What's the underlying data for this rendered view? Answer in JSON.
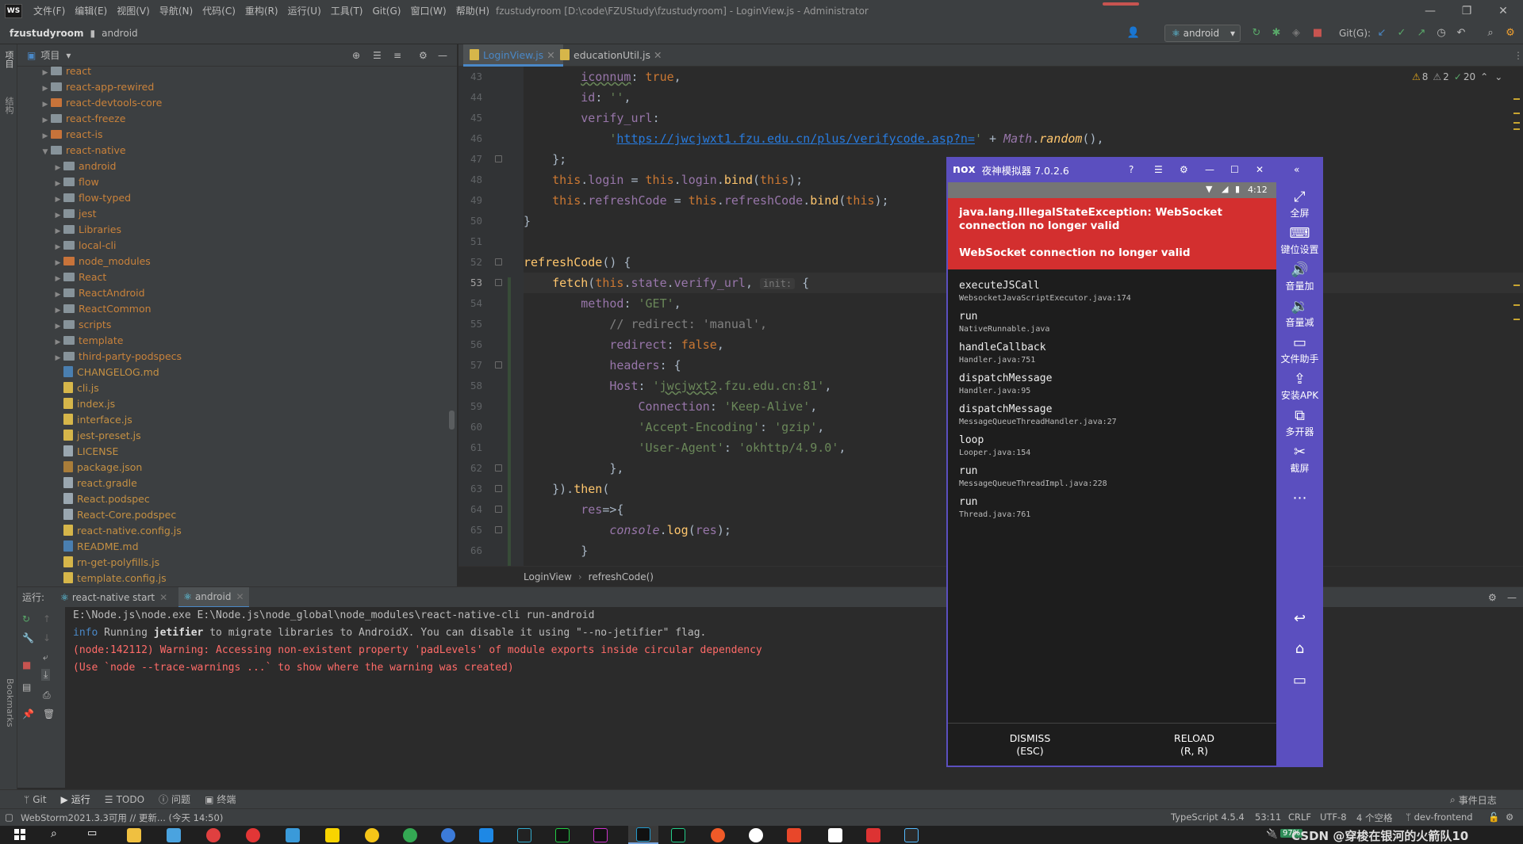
{
  "window": {
    "title": "fzustudyroom [D:\\code\\FZUStudy\\fzustudyroom] - LoginView.js - Administrator",
    "logo": "WS",
    "menus": [
      "文件(F)",
      "编辑(E)",
      "视图(V)",
      "导航(N)",
      "代码(C)",
      "重构(R)",
      "运行(U)",
      "工具(T)",
      "Git(G)",
      "窗口(W)",
      "帮助(H)"
    ],
    "controls": {
      "minimize": "—",
      "restore": "❐",
      "close": "✕"
    }
  },
  "navbar": {
    "project": "fzustudyroom",
    "folder": "android",
    "run_config": "android",
    "git_label": "Git(G):"
  },
  "project_panel": {
    "title": "项目",
    "tree": [
      {
        "label": "react",
        "type": "dir",
        "depth": 2,
        "expanded": false
      },
      {
        "label": "react-app-rewired",
        "type": "dir",
        "depth": 2,
        "expanded": false
      },
      {
        "label": "react-devtools-core",
        "type": "dir",
        "depth": 2,
        "expanded": false,
        "excluded": true
      },
      {
        "label": "react-freeze",
        "type": "dir",
        "depth": 2,
        "expanded": false
      },
      {
        "label": "react-is",
        "type": "dir",
        "depth": 2,
        "expanded": false,
        "excluded": true
      },
      {
        "label": "react-native",
        "type": "dir",
        "depth": 2,
        "expanded": true
      },
      {
        "label": "android",
        "type": "dir",
        "depth": 3,
        "expanded": false
      },
      {
        "label": "flow",
        "type": "dir",
        "depth": 3,
        "expanded": false
      },
      {
        "label": "flow-typed",
        "type": "dir",
        "depth": 3,
        "expanded": false
      },
      {
        "label": "jest",
        "type": "dir",
        "depth": 3,
        "expanded": false
      },
      {
        "label": "Libraries",
        "type": "dir",
        "depth": 3,
        "expanded": false
      },
      {
        "label": "local-cli",
        "type": "dir",
        "depth": 3,
        "expanded": false
      },
      {
        "label": "node_modules",
        "type": "dir",
        "depth": 3,
        "expanded": false,
        "excluded": true
      },
      {
        "label": "React",
        "type": "dir",
        "depth": 3,
        "expanded": false
      },
      {
        "label": "ReactAndroid",
        "type": "dir",
        "depth": 3,
        "expanded": false
      },
      {
        "label": "ReactCommon",
        "type": "dir",
        "depth": 3,
        "expanded": false
      },
      {
        "label": "scripts",
        "type": "dir",
        "depth": 3,
        "expanded": false
      },
      {
        "label": "template",
        "type": "dir",
        "depth": 3,
        "expanded": false
      },
      {
        "label": "third-party-podspecs",
        "type": "dir",
        "depth": 3,
        "expanded": false
      },
      {
        "label": "CHANGELOG.md",
        "type": "md",
        "depth": 3
      },
      {
        "label": "cli.js",
        "type": "js",
        "depth": 3
      },
      {
        "label": "index.js",
        "type": "js",
        "depth": 3
      },
      {
        "label": "interface.js",
        "type": "js",
        "depth": 3
      },
      {
        "label": "jest-preset.js",
        "type": "js",
        "depth": 3
      },
      {
        "label": "LICENSE",
        "type": "txt",
        "depth": 3
      },
      {
        "label": "package.json",
        "type": "json",
        "depth": 3
      },
      {
        "label": "react.gradle",
        "type": "txt",
        "depth": 3
      },
      {
        "label": "React.podspec",
        "type": "txt",
        "depth": 3
      },
      {
        "label": "React-Core.podspec",
        "type": "txt",
        "depth": 3
      },
      {
        "label": "react-native.config.js",
        "type": "js",
        "depth": 3
      },
      {
        "label": "README.md",
        "type": "md",
        "depth": 3
      },
      {
        "label": "rn-get-polyfills.js",
        "type": "js",
        "depth": 3
      },
      {
        "label": "template.config.js",
        "type": "js",
        "depth": 3
      }
    ]
  },
  "editor": {
    "tabs": [
      {
        "label": "LoginView.js",
        "active": true
      },
      {
        "label": "educationUtil.js",
        "active": false
      }
    ],
    "inspections": {
      "warnings": "8",
      "weak": "2",
      "ok": "20"
    },
    "line_numbers": [
      "43",
      "44",
      "45",
      "46",
      "47",
      "48",
      "49",
      "50",
      "51",
      "52",
      "53",
      "54",
      "55",
      "56",
      "57",
      "58",
      "59",
      "60",
      "61",
      "62",
      "63",
      "64",
      "65",
      "66"
    ],
    "current_line": "53",
    "breadcrumb": [
      "LoginView",
      "refreshCode()"
    ]
  },
  "run_panel": {
    "label": "运行:",
    "tabs": [
      "react-native start",
      "android"
    ],
    "lines": [
      {
        "text": "E:\\Node.js\\node.exe E:\\Node.js\\node_global\\node_modules\\react-native-cli run-android",
        "color": "#bbbbbb"
      },
      {
        "text": "(node:142112) Warning: Accessing non-existent property 'padLevels' of module exports inside circular dependency",
        "color": "#ff6b68"
      },
      {
        "text": "(Use `node --trace-warnings ...` to show where the warning was created)",
        "color": "#ff6b68"
      }
    ],
    "info_line": {
      "prefix": "info",
      "mid": " Running ",
      "bold": "jetifier",
      "rest": " to migrate libraries to AndroidX. You can disable it using \"--no-jetifier\" flag."
    }
  },
  "bottom_tools": [
    "Git",
    "运行",
    "TODO",
    "问题",
    "终端"
  ],
  "event_log": "事件日志",
  "status": {
    "left": "WebStorm2021.3.3可用 // 更新... (今天 14:50)",
    "lang": "TypeScript 4.5.4",
    "pos": "53:11",
    "eol": "CRLF",
    "enc": "UTF-8",
    "indent": "4 个空格",
    "branch": "dev-frontend"
  },
  "side_labels": {
    "project": "项目",
    "structure": "结构",
    "bookmarks": "Bookmarks"
  },
  "emulator": {
    "brand": "nox",
    "title": "夜神模拟器 7.0.2.6",
    "clock": "4:12",
    "error_title": "java.lang.IllegalStateException: WebSocket connection no longer valid",
    "error_msg": "WebSocket connection no longer valid",
    "frames": [
      {
        "fn": "executeJSCall",
        "file": "WebsocketJavaScriptExecutor.java:174"
      },
      {
        "fn": "run",
        "file": "NativeRunnable.java"
      },
      {
        "fn": "handleCallback",
        "file": "Handler.java:751"
      },
      {
        "fn": "dispatchMessage",
        "file": "Handler.java:95"
      },
      {
        "fn": "dispatchMessage",
        "file": "MessageQueueThreadHandler.java:27"
      },
      {
        "fn": "loop",
        "file": "Looper.java:154"
      },
      {
        "fn": "run",
        "file": "MessageQueueThreadImpl.java:228"
      },
      {
        "fn": "run",
        "file": "Thread.java:761"
      }
    ],
    "buttons": [
      {
        "label": "DISMISS",
        "key": "(ESC)"
      },
      {
        "label": "RELOAD",
        "key": "(R, R)"
      }
    ],
    "side": [
      "全屏",
      "键位设置",
      "音量加",
      "音量减",
      "文件助手",
      "安装APK",
      "多开器",
      "截屏"
    ]
  },
  "taskbar": {
    "battery": "97%",
    "watermark": "CSDN @穿梭在银河的火箭队10"
  },
  "colors": {
    "accent": "#4a88c7",
    "error_red": "#d32f2f",
    "nox_purple": "#5b4fbf",
    "keyword": "#cc7832",
    "string": "#6a8759"
  }
}
